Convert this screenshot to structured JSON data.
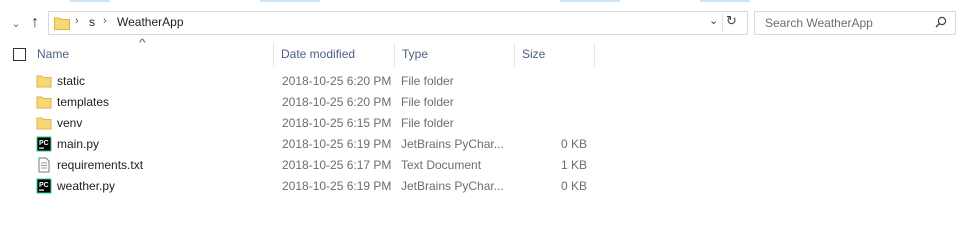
{
  "address": {
    "crumbs": [
      "s",
      "WeatherApp"
    ],
    "sep_glyph": "›",
    "dropdown_glyph": "⌄",
    "refresh_glyph": "↻"
  },
  "nav": {
    "chevron_glyph": "⌄",
    "up_glyph": "↑"
  },
  "search": {
    "placeholder": "Search WeatherApp"
  },
  "columns": {
    "name": "Name",
    "date": "Date modified",
    "type": "Type",
    "size": "Size",
    "sort_glyph": "^"
  },
  "files": [
    {
      "name": "static",
      "date": "2018-10-25 6:20 PM",
      "type": "File folder",
      "size": "",
      "icon": "folder-icon"
    },
    {
      "name": "templates",
      "date": "2018-10-25 6:20 PM",
      "type": "File folder",
      "size": "",
      "icon": "folder-icon"
    },
    {
      "name": "venv",
      "date": "2018-10-25 6:15 PM",
      "type": "File folder",
      "size": "",
      "icon": "folder-icon"
    },
    {
      "name": "main.py",
      "date": "2018-10-25 6:19 PM",
      "type": "JetBrains PyChar...",
      "size": "0 KB",
      "icon": "pycharm-file-icon"
    },
    {
      "name": "requirements.txt",
      "date": "2018-10-25 6:17 PM",
      "type": "Text Document",
      "size": "1 KB",
      "icon": "text-file-icon"
    },
    {
      "name": "weather.py",
      "date": "2018-10-25 6:19 PM",
      "type": "JetBrains PyChar...",
      "size": "0 KB",
      "icon": "pycharm-file-icon"
    }
  ],
  "colors": {
    "folder": "#f8d775",
    "folder_dark": "#e0b44a",
    "header_text": "#4d6082",
    "accent": "#2b7cd3"
  }
}
